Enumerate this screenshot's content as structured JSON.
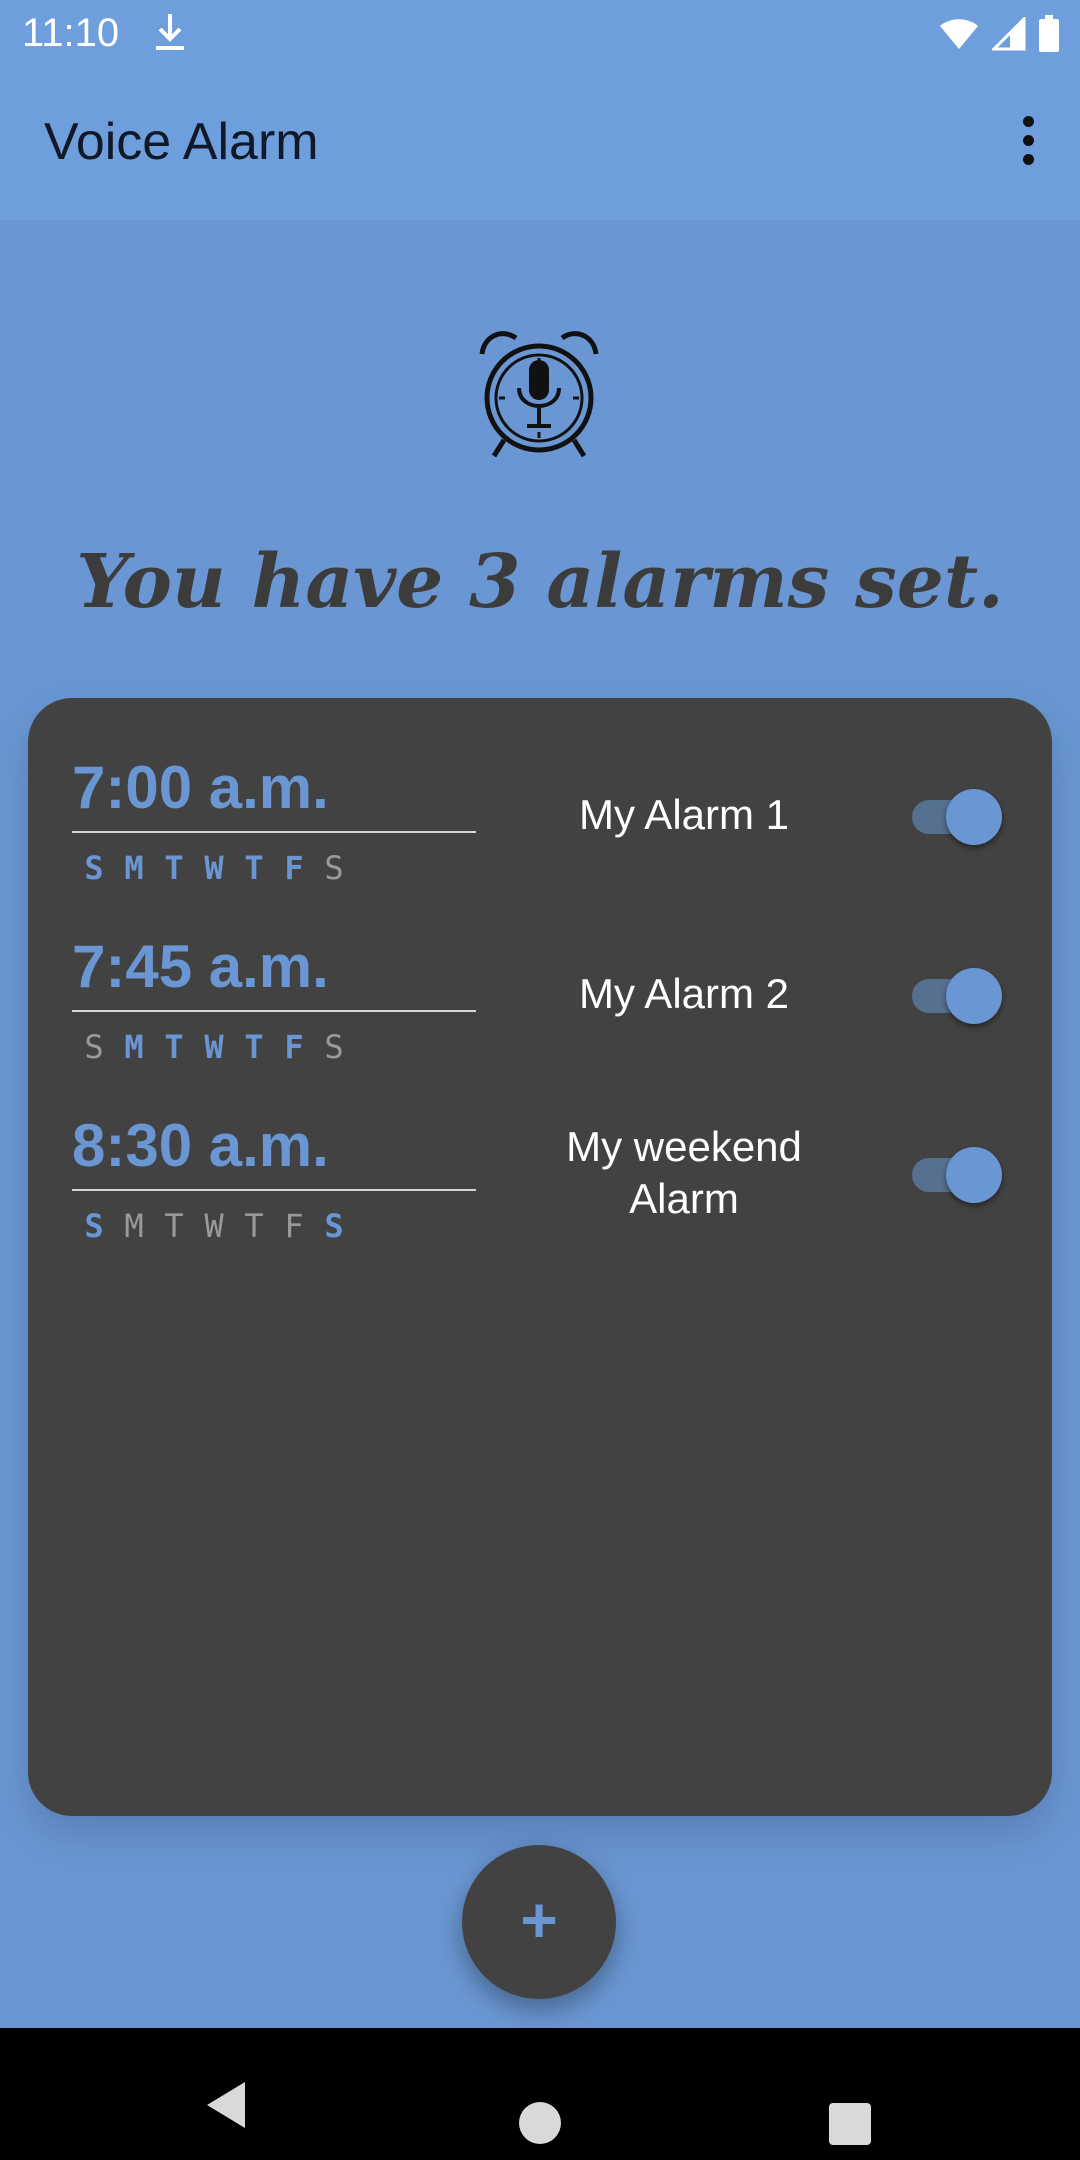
{
  "status_bar": {
    "time": "11:10",
    "icons": [
      "download-icon",
      "wifi-icon",
      "signal-icon",
      "battery-icon"
    ]
  },
  "app_bar": {
    "title": "Voice Alarm",
    "menu_icon": "more-vert-icon"
  },
  "hero": {
    "icon": "alarm-clock-microphone-icon",
    "headline": "You have 3 alarms set."
  },
  "alarms": [
    {
      "time": "7:00 a.m.",
      "label": "My Alarm 1",
      "enabled": true,
      "days": [
        {
          "letter": "S",
          "on": true
        },
        {
          "letter": "M",
          "on": true
        },
        {
          "letter": "T",
          "on": true
        },
        {
          "letter": "W",
          "on": true
        },
        {
          "letter": "T",
          "on": true
        },
        {
          "letter": "F",
          "on": true
        },
        {
          "letter": "S",
          "on": false
        }
      ]
    },
    {
      "time": "7:45 a.m.",
      "label": "My Alarm 2",
      "enabled": true,
      "days": [
        {
          "letter": "S",
          "on": false
        },
        {
          "letter": "M",
          "on": true
        },
        {
          "letter": "T",
          "on": true
        },
        {
          "letter": "W",
          "on": true
        },
        {
          "letter": "T",
          "on": true
        },
        {
          "letter": "F",
          "on": true
        },
        {
          "letter": "S",
          "on": false
        }
      ]
    },
    {
      "time": "8:30 a.m.",
      "label": "My weekend Alarm",
      "enabled": true,
      "days": [
        {
          "letter": "S",
          "on": true
        },
        {
          "letter": "M",
          "on": false
        },
        {
          "letter": "T",
          "on": false
        },
        {
          "letter": "W",
          "on": false
        },
        {
          "letter": "T",
          "on": false
        },
        {
          "letter": "F",
          "on": false
        },
        {
          "letter": "S",
          "on": true
        }
      ]
    }
  ],
  "fab": {
    "label": "+",
    "icon": "add-icon"
  },
  "nav_bar": {
    "icons": [
      "back-icon",
      "home-icon",
      "recents-icon"
    ]
  },
  "colors": {
    "background": "#6a97d3",
    "app_bar": "#6e9fdc",
    "card": "#424242",
    "accent": "#6a97d3",
    "day_off": "#9a9a9a",
    "headline": "#3c3c3c"
  }
}
